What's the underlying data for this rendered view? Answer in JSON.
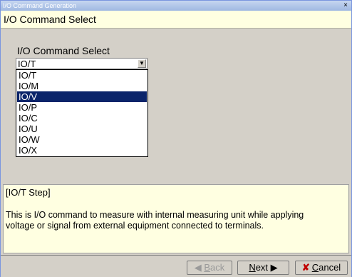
{
  "window": {
    "title": "I/O Command Generation",
    "close_glyph": "×"
  },
  "header": {
    "title": "I/O Command Select"
  },
  "form": {
    "label": "I/O Command Select",
    "selected_value": "IO/T",
    "options": [
      "IO/T",
      "IO/M",
      "IO/V",
      "IO/P",
      "IO/C",
      "IO/U",
      "IO/W",
      "IO/X"
    ],
    "highlighted_option": "IO/V"
  },
  "description": {
    "title": "[IO/T Step]",
    "line1": "This is I/O command to measure with internal measuring unit while applying",
    "line2": "voltage or signal from external equipment connected to terminals."
  },
  "footer": {
    "back_label_prefix": "",
    "back_label_u": "B",
    "back_label_rest": "ack",
    "next_label_u": "N",
    "next_label_rest": "ext",
    "cancel_label_u": "C",
    "cancel_label_rest": "ancel"
  },
  "colors": {
    "selection": "#0a246a",
    "info_background": "#ffffe1",
    "cancel_icon": "#c00000"
  }
}
